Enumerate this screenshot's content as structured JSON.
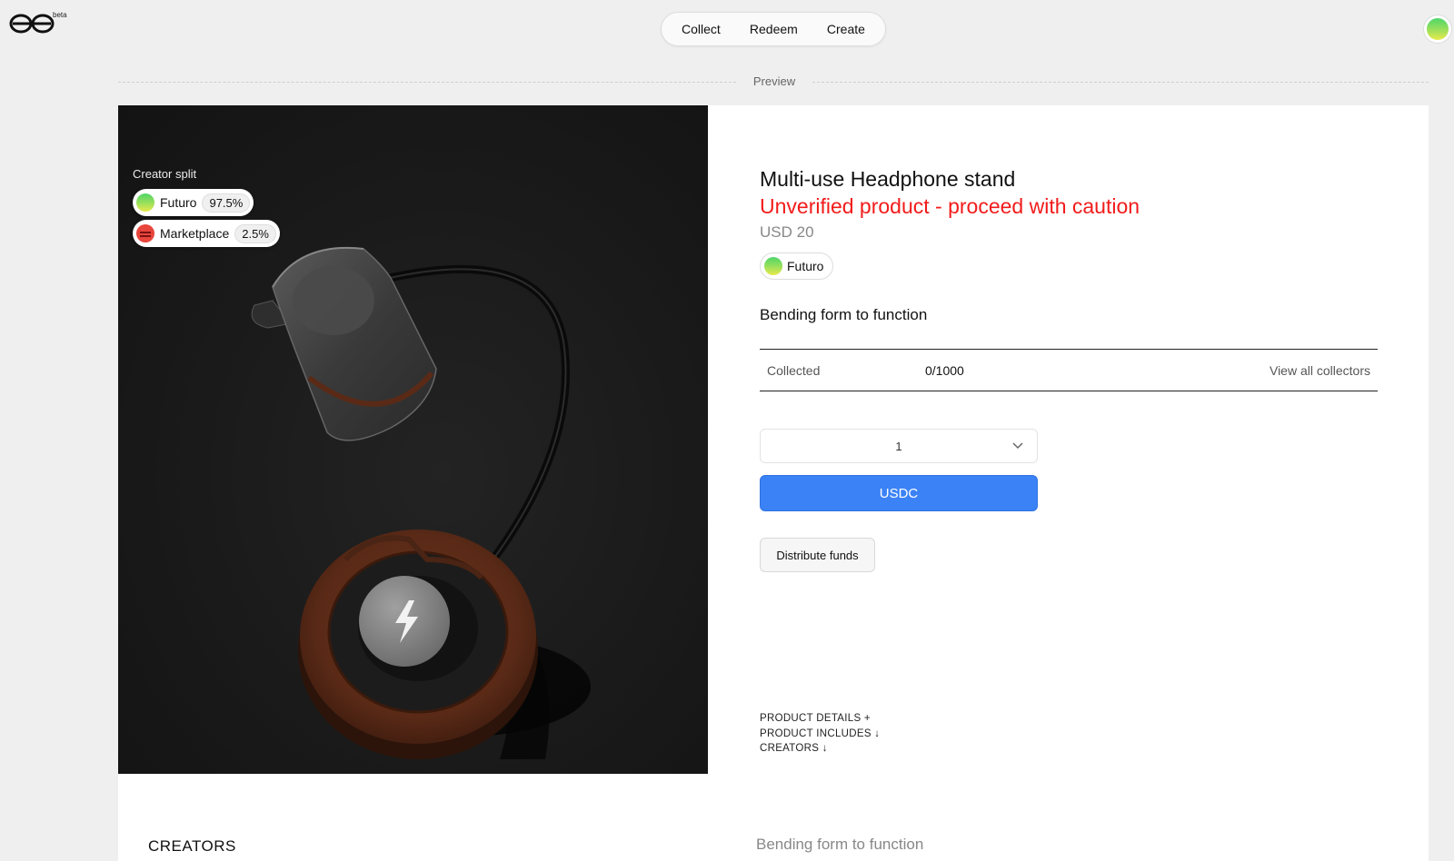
{
  "header": {
    "logo_icon": "brand-logo-icon",
    "beta_label": "beta",
    "nav": [
      "Collect",
      "Redeem",
      "Create"
    ],
    "avatar_icon": "user-avatar"
  },
  "preview_label": "Preview",
  "media": {
    "split_title": "Creator split",
    "splits": [
      {
        "name": "Futuro",
        "percent": "97.5%",
        "avatar": "green-gradient-avatar"
      },
      {
        "name": "Marketplace",
        "percent": "2.5%",
        "avatar": "red-marketplace-avatar"
      }
    ]
  },
  "product": {
    "title": "Multi-use Headphone stand",
    "warning": "Unverified product - proceed with caution",
    "price": "USD 20",
    "creator": "Futuro",
    "tagline": "Bending form to function",
    "collected_label": "Collected",
    "collected_value": "0/1000",
    "view_collectors": "View all collectors",
    "quantity": "1",
    "pay_label": "USDC",
    "distribute_label": "Distribute funds",
    "accordion": [
      "PRODUCT DETAILS +",
      "PRODUCT INCLUDES ↓",
      "CREATORS ↓"
    ]
  },
  "bottom": {
    "creators_heading": "CREATORS",
    "tagline": "Bending form to function"
  },
  "colors": {
    "accent_blue": "#3b82f6",
    "warning_red": "#f21b1b",
    "media_bg": "#1a1a1a"
  }
}
